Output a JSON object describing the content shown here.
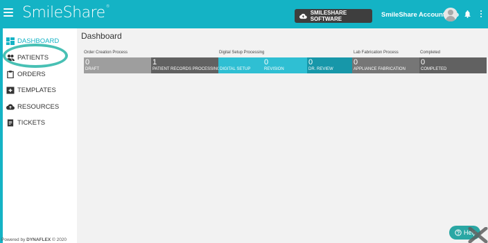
{
  "header": {
    "logo_text": "SmileShare",
    "logo_mark": "®",
    "software_button": "SMILESHARE SOFTWARE",
    "account_label": "SmileShare Account Info",
    "menu_icon": "hamburger-menu-icon",
    "bell_icon": "bell-icon",
    "more_icon": "kebab-menu-icon"
  },
  "sidebar": {
    "items": [
      {
        "label": "DASHBOARD",
        "icon": "dashboard-icon",
        "active": true
      },
      {
        "label": "PATIENTS",
        "icon": "people-icon"
      },
      {
        "label": "ORDERS",
        "icon": "clipboard-icon"
      },
      {
        "label": "TEMPLATES",
        "icon": "template-icon"
      },
      {
        "label": "RESOURCES",
        "icon": "cloud-icon"
      },
      {
        "label": "TICKETS",
        "icon": "ticket-icon"
      }
    ],
    "powered_prefix": "Powered by",
    "powered_brand": "DYNAFLEX",
    "powered_suffix": "© 2020"
  },
  "main": {
    "title": "Dashboard",
    "groups": [
      "Order Creation Process",
      "Digital Setup Processing",
      "Lab Fabrication Process",
      "Completed"
    ],
    "tiles": [
      {
        "count": "0",
        "label": "DRAFT"
      },
      {
        "count": "1",
        "label": "PATIENT RECORDS PROCESSING"
      },
      {
        "count": "",
        "label": "DIGITAL SETUP"
      },
      {
        "count": "0",
        "label": "REVISION"
      },
      {
        "count": "0",
        "label": "DR. REVIEW"
      },
      {
        "count": "0",
        "label": "APPLIANCE FABRICATION"
      },
      {
        "count": "0",
        "label": "COMPLETED"
      }
    ]
  },
  "help": {
    "label": "Help",
    "icon": "question-circle-icon"
  },
  "colors": {
    "brand": "#14b3c5",
    "highlight": "#48c0b4",
    "help_button": "#2aa7a4"
  }
}
